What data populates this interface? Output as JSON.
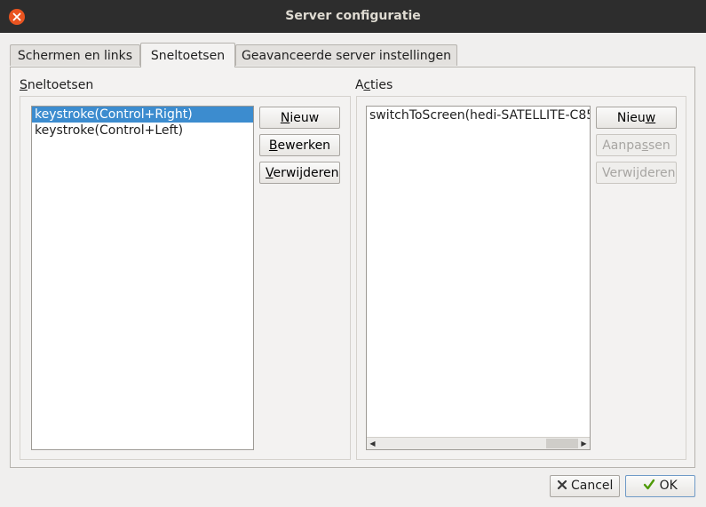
{
  "window": {
    "title": "Server configuratie"
  },
  "tabs": [
    {
      "label": "Schermen en links"
    },
    {
      "label": "Sneltoetsen"
    },
    {
      "label": "Geavanceerde server instellingen"
    }
  ],
  "hotkeys": {
    "group_label": "Sneltoetsen",
    "items": [
      "keystroke(Control+Right)",
      "keystroke(Control+Left)"
    ],
    "selected_index": 0,
    "buttons": {
      "new": "Nieuw",
      "edit": "Bewerken",
      "remove": "Verwijderen"
    }
  },
  "actions": {
    "group_label": "Acties",
    "items": [
      "switchToScreen(hedi-SATELLITE-C85"
    ],
    "buttons": {
      "new": "Nieuw",
      "edit": "Aanpassen",
      "remove": "Verwijderen"
    },
    "edit_enabled": false,
    "remove_enabled": false
  },
  "footer": {
    "cancel": "Cancel",
    "ok": "OK"
  },
  "colors": {
    "accent": "#e95420",
    "selection": "#3c8ccf",
    "titlebar": "#2d2d2d"
  },
  "icons": {
    "close": "close-icon",
    "cancel": "x-icon",
    "ok": "checkmark-icon"
  }
}
